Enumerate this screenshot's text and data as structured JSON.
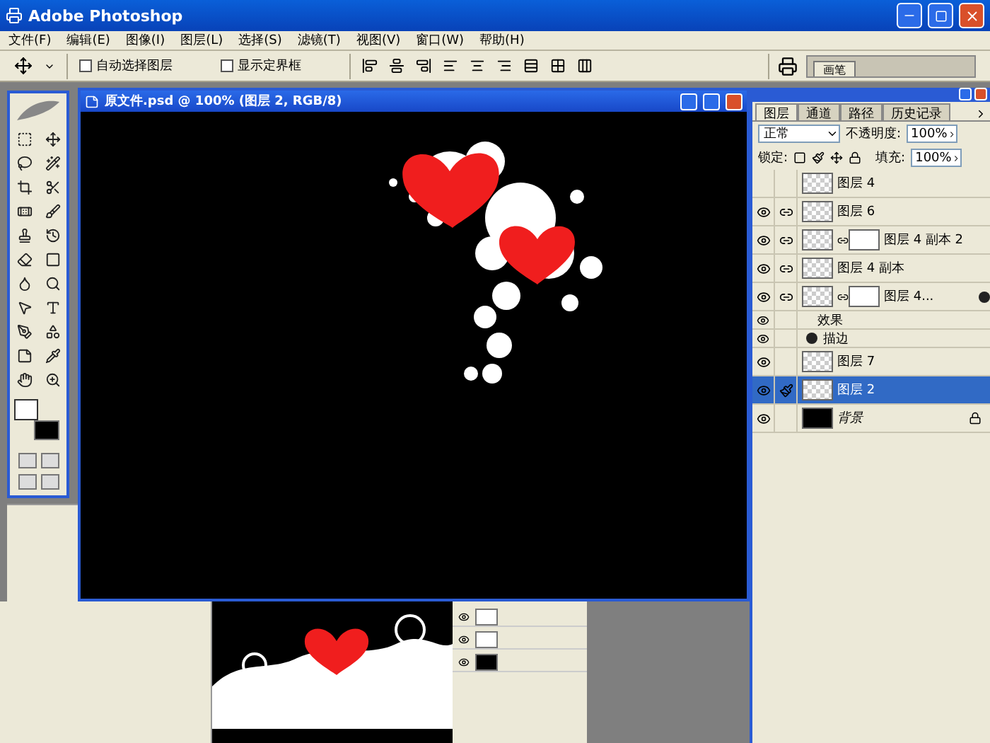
{
  "window": {
    "title": "Adobe Photoshop"
  },
  "menu": [
    "文件(F)",
    "编辑(E)",
    "图像(I)",
    "图层(L)",
    "选择(S)",
    "滤镜(T)",
    "视图(V)",
    "窗口(W)",
    "帮助(H)"
  ],
  "options_bar": {
    "checkboxes": [
      {
        "label": "自动选择图层",
        "checked": false
      },
      {
        "label": "显示定界框",
        "checked": false
      }
    ]
  },
  "palette_well": {
    "tabs": [
      "画笔"
    ]
  },
  "document": {
    "title": "原文件.psd @ 100% (图层 2, RGB/8)"
  },
  "layers_panel": {
    "tabs": [
      {
        "label": "图层",
        "selected": true
      },
      {
        "label": "通道",
        "selected": false
      },
      {
        "label": "路径",
        "selected": false
      },
      {
        "label": "历史记录",
        "selected": false
      }
    ],
    "blend_mode": "正常",
    "opacity_label": "不透明度:",
    "opacity": "100%",
    "lock_label": "锁定:",
    "fill_label": "填充:",
    "fill": "100%",
    "layers": [
      {
        "kind": "layer",
        "name": "图层 4",
        "visible": false,
        "linked": false,
        "mask": false,
        "fx": false,
        "selected": false
      },
      {
        "kind": "layer",
        "name": "图层 6",
        "visible": true,
        "linked": true,
        "mask": false,
        "fx": false,
        "selected": false
      },
      {
        "kind": "layer",
        "name": "图层 4 副本 2",
        "visible": true,
        "linked": true,
        "mask": true,
        "fx": false,
        "selected": false
      },
      {
        "kind": "layer",
        "name": "图层 4 副本",
        "visible": true,
        "linked": true,
        "mask": false,
        "fx": false,
        "selected": false
      },
      {
        "kind": "layer",
        "name": "图层 4...",
        "visible": true,
        "linked": true,
        "mask": true,
        "fx": true,
        "selected": false,
        "effects": [
          {
            "label": "效果",
            "kind": "header"
          },
          {
            "label": "描边",
            "kind": "effect"
          }
        ]
      },
      {
        "kind": "layer",
        "name": "图层 7",
        "visible": true,
        "linked": false,
        "mask": false,
        "fx": false,
        "selected": false
      },
      {
        "kind": "layer",
        "name": "图层 2",
        "visible": true,
        "linked": false,
        "mask": false,
        "fx": false,
        "selected": true
      },
      {
        "kind": "background",
        "name": "背景",
        "visible": true,
        "linked": false,
        "mask": false,
        "fx": false,
        "selected": false
      }
    ]
  }
}
